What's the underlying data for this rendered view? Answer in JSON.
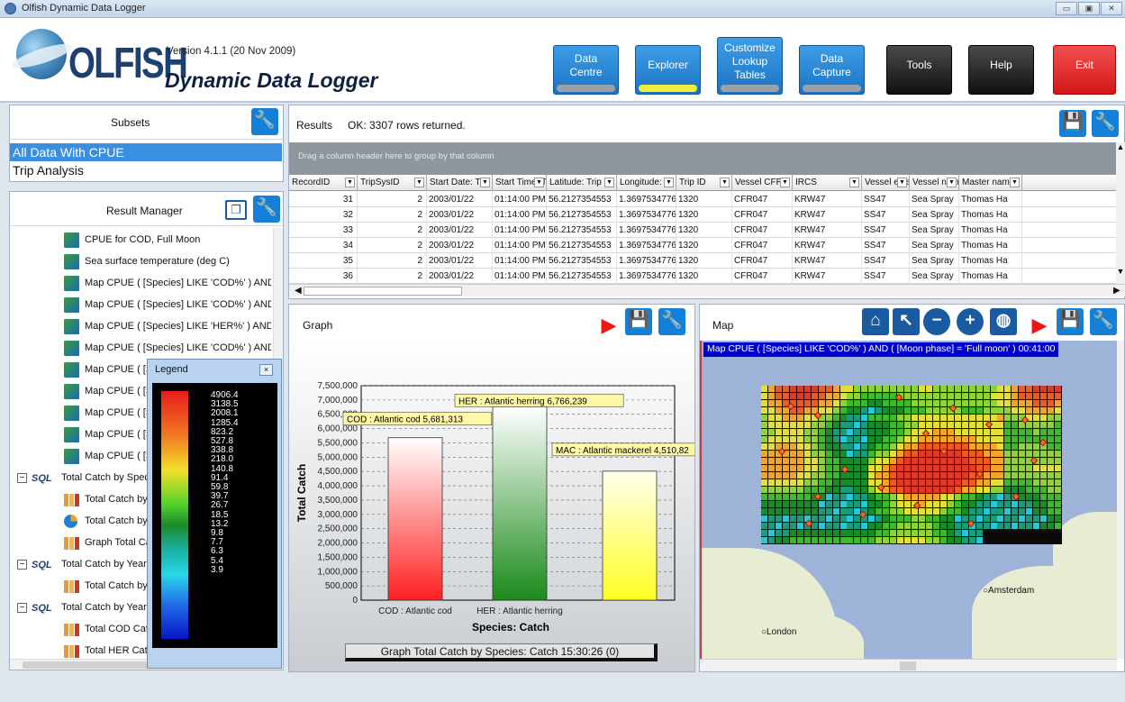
{
  "window": {
    "title": "Olfish Dynamic Data Logger",
    "controls": [
      "▭",
      "▣",
      "✕"
    ]
  },
  "header": {
    "logo_text": "OLFISH",
    "version": "Version 4.1.1 (20 Nov 2009)",
    "subtitle": "Dynamic Data Logger",
    "nav": [
      {
        "label": "Data Centre"
      },
      {
        "label": "Explorer"
      },
      {
        "label": "Customize Lookup Tables"
      },
      {
        "label": "Data Capture"
      },
      {
        "label": "Tools"
      },
      {
        "label": "Help"
      },
      {
        "label": "Exit"
      }
    ]
  },
  "subsets": {
    "title": "Subsets",
    "items": [
      "All Data With CPUE",
      "Trip Analysis"
    ]
  },
  "result_manager": {
    "title": "Result Manager",
    "items": [
      {
        "kind": "map",
        "label": "CPUE for COD, Full Moon"
      },
      {
        "kind": "map",
        "label": "Sea surface temperature (deg C)"
      },
      {
        "kind": "map",
        "label": "Map CPUE  ( [Species] LIKE 'COD%' ) AND"
      },
      {
        "kind": "map",
        "label": "Map CPUE  ( [Species] LIKE 'COD%' ) AND"
      },
      {
        "kind": "map",
        "label": "Map CPUE  ( [Species] LIKE 'HER%' ) AND"
      },
      {
        "kind": "map",
        "label": "Map CPUE  ( [Species] LIKE 'COD%' ) AND"
      },
      {
        "kind": "map",
        "label": "Map CPUE  ( [S"
      },
      {
        "kind": "map",
        "label": "Map CPUE  ( [S"
      },
      {
        "kind": "map",
        "label": "Map CPUE  ( [S"
      },
      {
        "kind": "map",
        "label": "Map CPUE  ( [S"
      },
      {
        "kind": "map",
        "label": "Map CPUE  ( [S"
      },
      {
        "kind": "sql",
        "label": "Total Catch by Spec"
      },
      {
        "kind": "bar",
        "label": "Total Catch by"
      },
      {
        "kind": "pie",
        "label": "Total Catch by"
      },
      {
        "kind": "bar",
        "label": "Graph Total Ca"
      },
      {
        "kind": "sql",
        "label": "Total Catch by Year"
      },
      {
        "kind": "bar",
        "label": "Total Catch by"
      },
      {
        "kind": "sql",
        "label": "Total Catch by Year,"
      },
      {
        "kind": "bar",
        "label": "Total COD Cat"
      },
      {
        "kind": "bar",
        "label": "Total HER Cat"
      }
    ]
  },
  "legend": {
    "title": "Legend",
    "values": [
      "4906.4",
      "3138.5",
      "2008.1",
      "1285.4",
      "823.2",
      "527.8",
      "338.8",
      "218.0",
      "140.8",
      "91.4",
      "59.8",
      "39.7",
      "26.7",
      "18.5",
      "13.2",
      "9.8",
      "7.7",
      "6.3",
      "5.4",
      "3.9"
    ]
  },
  "results": {
    "title": "Results",
    "status": "OK: 3307 rows returned.",
    "group_hint": "Drag a column header here to group by that column",
    "columns": [
      "RecordID",
      "TripSysID",
      "Start Date: T",
      "Start Time: T",
      "Latitude: Trip",
      "Longitude: T",
      "Trip ID",
      "Vessel CFR",
      "IRCS",
      "Vessel exter",
      "Vessel name",
      "Master nam"
    ],
    "rows": [
      [
        "31",
        "2",
        "2003/01/22",
        "01:14:00 PM",
        "56.2127354553",
        "1.3697534776S",
        "1320",
        "CFR047",
        "KRW47",
        "SS47",
        "Sea Spray",
        "Thomas Ha"
      ],
      [
        "32",
        "2",
        "2003/01/22",
        "01:14:00 PM",
        "56.2127354553",
        "1.3697534776S",
        "1320",
        "CFR047",
        "KRW47",
        "SS47",
        "Sea Spray",
        "Thomas Ha"
      ],
      [
        "33",
        "2",
        "2003/01/22",
        "01:14:00 PM",
        "56.2127354553",
        "1.3697534776S",
        "1320",
        "CFR047",
        "KRW47",
        "SS47",
        "Sea Spray",
        "Thomas Ha"
      ],
      [
        "34",
        "2",
        "2003/01/22",
        "01:14:00 PM",
        "56.2127354553",
        "1.3697534776S",
        "1320",
        "CFR047",
        "KRW47",
        "SS47",
        "Sea Spray",
        "Thomas Ha"
      ],
      [
        "35",
        "2",
        "2003/01/22",
        "01:14:00 PM",
        "56.2127354553",
        "1.3697534776S",
        "1320",
        "CFR047",
        "KRW47",
        "SS47",
        "Sea Spray",
        "Thomas Ha"
      ],
      [
        "36",
        "2",
        "2003/01/22",
        "01:14:00 PM",
        "56.2127354553",
        "1.3697534776S",
        "1320",
        "CFR047",
        "KRW47",
        "SS47",
        "Sea Spray",
        "Thomas Ha"
      ]
    ]
  },
  "graph": {
    "title": "Graph",
    "caption": "Graph Total Catch by Species: Catch  15:30:26 (0)"
  },
  "chart_data": {
    "type": "bar",
    "categories": [
      "COD : Atlantic cod",
      "HER : Atlantic herring",
      "MAC : Atlantic mackerel"
    ],
    "values": [
      5681313,
      6766239,
      4510820
    ],
    "data_labels": [
      "COD : Atlantic cod 5,681,313",
      "HER : Atlantic herring 6,766,239",
      "MAC : Atlantic mackerel 4,510,82"
    ],
    "tick_labels": [
      "COD : Atlantic cod",
      "HER : Atlantic herring",
      ""
    ],
    "colors": [
      "#ff2020",
      "#1a8a1a",
      "#ffff22"
    ],
    "xlabel": "Species: Catch",
    "ylabel": "Total Catch",
    "ylim": [
      0,
      7500000
    ],
    "yticks": [
      "0",
      "500,000",
      "1,000,000",
      "1,500,000",
      "2,000,000",
      "2,500,000",
      "3,000,000",
      "3,500,000",
      "4,000,000",
      "4,500,000",
      "5,000,000",
      "5,500,000",
      "6,000,000",
      "6,500,000",
      "7,000,000",
      "7,500,000"
    ],
    "grid": true
  },
  "map": {
    "title": "Map",
    "layer_label": "Map CPUE  ( [Species] LIKE 'COD%' ) AND  ( [Moon phase] = 'Full moon' )  00:41:00",
    "cities": [
      "Amsterdam",
      "London"
    ]
  },
  "toolbar_icons": {
    "wrench": "🔧",
    "save": "💾",
    "play": "▶",
    "home": "⌂",
    "pointer": "↖",
    "zoom_out": "−",
    "zoom_in": "+",
    "globe": "◍",
    "restore": "❐"
  }
}
